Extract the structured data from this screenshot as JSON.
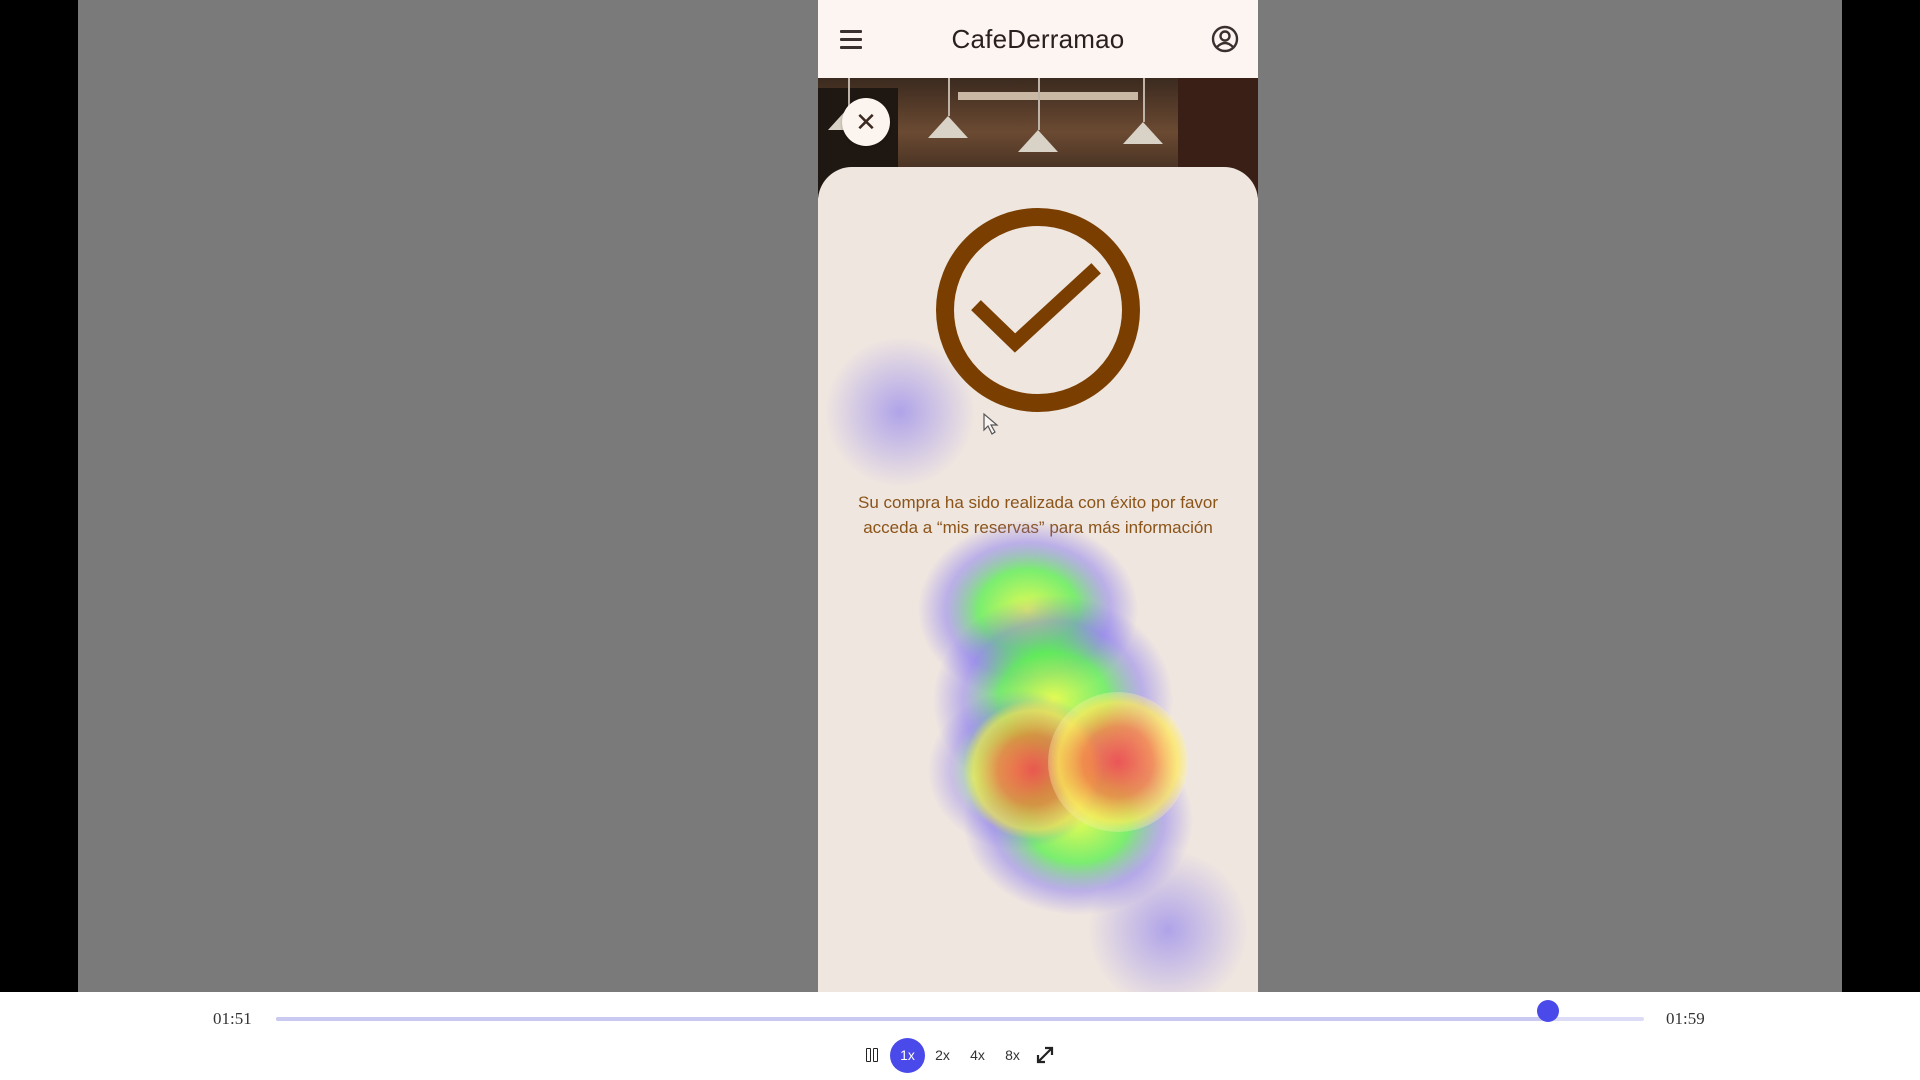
{
  "app": {
    "title": "CafeDerramao",
    "icons": {
      "menu": "menu-icon",
      "account": "account-circle-icon",
      "close": "close-icon",
      "success": "check-circle-icon"
    },
    "close_label": "✕",
    "success_message_line1": "Su compra ha sido realizada con éxito por favor",
    "success_message_line2": "acceda a “mis reservas” para más información",
    "colors": {
      "accent_brown": "#7a3f00",
      "text_brown": "#8b5418",
      "appbar_bg": "#fdf5f2",
      "sheet_bg": "#efe6e0"
    }
  },
  "player": {
    "current_time": "01:51",
    "total_time": "01:59",
    "progress": 0.93,
    "speeds": [
      "1x",
      "2x",
      "4x",
      "8x"
    ],
    "active_speed": "1x",
    "icons": {
      "pause": "pause-icon",
      "fullscreen": "fullscreen-icon"
    },
    "accent_color": "#4a49ea"
  }
}
